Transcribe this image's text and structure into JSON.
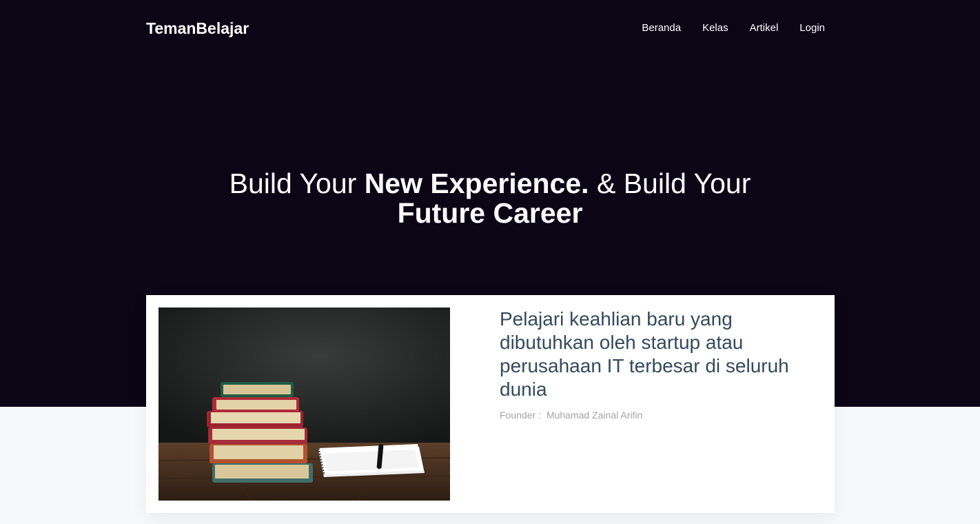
{
  "brand": "TemanBelajar",
  "nav": [
    "Beranda",
    "Kelas",
    "Artikel",
    "Login"
  ],
  "hero": {
    "part1": "Build Your ",
    "part2": "New Experience.",
    "part3": " & Build Your ",
    "part4": "Future Career"
  },
  "card": {
    "title": "Pelajari keahlian baru yang dibutuhkan oleh startup atau perusahaan IT terbesar di seluruh dunia",
    "founder_label": "Founder :",
    "founder_name": "Muhamad Zainal Arifin"
  },
  "colors": {
    "hero_bg": "#0c0516",
    "title_color": "#34495e",
    "page_bg": "#f7f8fa"
  },
  "image": {
    "subject": "stack-of-books-and-notebook"
  }
}
